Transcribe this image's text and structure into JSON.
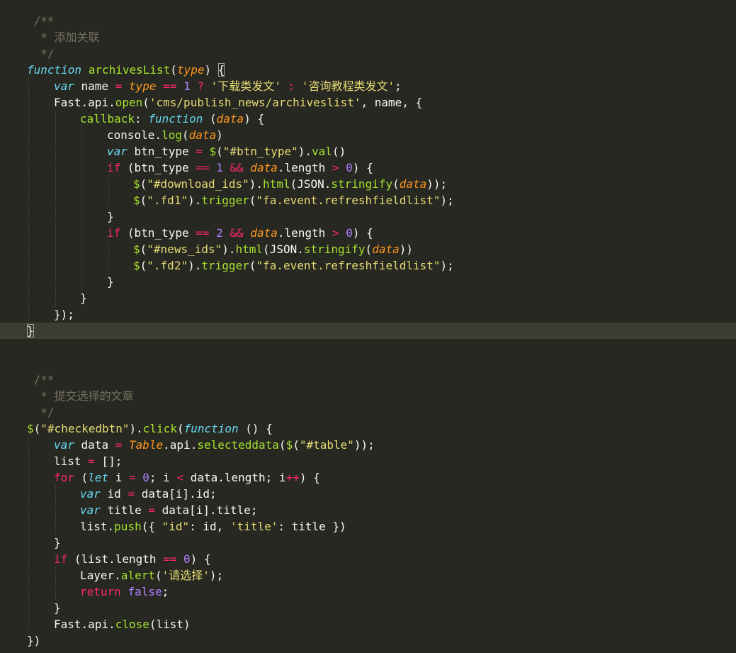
{
  "editor": {
    "theme": "monokai",
    "colors": {
      "background": "#272822",
      "active_line": "#3e3d32",
      "text": "#f8f8f2",
      "comment": "#75715e",
      "keyword": "#66d9ef",
      "function": "#a6e22e",
      "parameter": "#fd971f",
      "string": "#e6db74",
      "operator": "#f92672",
      "number": "#ae81ff"
    },
    "active_line_index": 19,
    "lines": [
      {
        "indent": 0,
        "tokens": [
          [
            " /**",
            "c"
          ]
        ]
      },
      {
        "indent": 0,
        "tokens": [
          [
            "  * 添加关联",
            "c"
          ]
        ]
      },
      {
        "indent": 0,
        "tokens": [
          [
            "  */",
            "c"
          ]
        ]
      },
      {
        "indent": 0,
        "tokens": [
          [
            "function",
            "k"
          ],
          [
            " ",
            "p"
          ],
          [
            "archivesList",
            "f"
          ],
          [
            "(",
            "p"
          ],
          [
            "type",
            "a"
          ],
          [
            ") ",
            "p"
          ],
          [
            "{",
            "p",
            "box"
          ]
        ]
      },
      {
        "indent": 1,
        "tokens": [
          [
            "var",
            "k"
          ],
          [
            " name ",
            "p"
          ],
          [
            "=",
            "o"
          ],
          [
            " ",
            "p"
          ],
          [
            "type",
            "a"
          ],
          [
            " ",
            "p"
          ],
          [
            "==",
            "o"
          ],
          [
            " ",
            "p"
          ],
          [
            "1",
            "n"
          ],
          [
            " ",
            "p"
          ],
          [
            "?",
            "o"
          ],
          [
            " ",
            "p"
          ],
          [
            "'下载类发文'",
            "s"
          ],
          [
            " ",
            "p"
          ],
          [
            ":",
            "o"
          ],
          [
            " ",
            "p"
          ],
          [
            "'咨询教程类发文'",
            "s"
          ],
          [
            ";",
            "p"
          ]
        ]
      },
      {
        "indent": 1,
        "tokens": [
          [
            "Fast",
            "p"
          ],
          [
            ".",
            "p"
          ],
          [
            "api",
            "p"
          ],
          [
            ".",
            "p"
          ],
          [
            "open",
            "f"
          ],
          [
            "(",
            "p"
          ],
          [
            "'cms/publish_news/archiveslist'",
            "s"
          ],
          [
            ", name, {",
            "p"
          ]
        ]
      },
      {
        "indent": 2,
        "tokens": [
          [
            "callback",
            "f"
          ],
          [
            ": ",
            "p"
          ],
          [
            "function",
            "k"
          ],
          [
            " (",
            "p"
          ],
          [
            "data",
            "a"
          ],
          [
            ") {",
            "p"
          ]
        ]
      },
      {
        "indent": 3,
        "tokens": [
          [
            "console",
            "p"
          ],
          [
            ".",
            "p"
          ],
          [
            "log",
            "f"
          ],
          [
            "(",
            "p"
          ],
          [
            "data",
            "a"
          ],
          [
            ")",
            "p"
          ]
        ]
      },
      {
        "indent": 3,
        "tokens": [
          [
            "var",
            "k"
          ],
          [
            " btn_type ",
            "p"
          ],
          [
            "=",
            "o"
          ],
          [
            " ",
            "p"
          ],
          [
            "$",
            "f"
          ],
          [
            "(",
            "p"
          ],
          [
            "\"#btn_type\"",
            "s"
          ],
          [
            ").",
            "p"
          ],
          [
            "val",
            "f"
          ],
          [
            "()",
            "p"
          ]
        ]
      },
      {
        "indent": 3,
        "tokens": [
          [
            "if",
            "ctl"
          ],
          [
            " (btn_type ",
            "p"
          ],
          [
            "==",
            "o"
          ],
          [
            " ",
            "p"
          ],
          [
            "1",
            "n"
          ],
          [
            " ",
            "p"
          ],
          [
            "&&",
            "o"
          ],
          [
            " ",
            "p"
          ],
          [
            "data",
            "a"
          ],
          [
            ".length ",
            "p"
          ],
          [
            ">",
            "o"
          ],
          [
            " ",
            "p"
          ],
          [
            "0",
            "n"
          ],
          [
            ") {",
            "p"
          ]
        ]
      },
      {
        "indent": 4,
        "tokens": [
          [
            "$",
            "f"
          ],
          [
            "(",
            "p"
          ],
          [
            "\"#download_ids\"",
            "s"
          ],
          [
            ").",
            "p"
          ],
          [
            "html",
            "f"
          ],
          [
            "(JSON.",
            "p"
          ],
          [
            "stringify",
            "f"
          ],
          [
            "(",
            "p"
          ],
          [
            "data",
            "a"
          ],
          [
            "));",
            "p"
          ]
        ]
      },
      {
        "indent": 4,
        "tokens": [
          [
            "$",
            "f"
          ],
          [
            "(",
            "p"
          ],
          [
            "\".fd1\"",
            "s"
          ],
          [
            ").",
            "p"
          ],
          [
            "trigger",
            "f"
          ],
          [
            "(",
            "p"
          ],
          [
            "\"fa.event.refreshfieldlist\"",
            "s"
          ],
          [
            ");",
            "p"
          ]
        ]
      },
      {
        "indent": 3,
        "tokens": [
          [
            "}",
            "p"
          ]
        ]
      },
      {
        "indent": 3,
        "tokens": [
          [
            "if",
            "ctl"
          ],
          [
            " (btn_type ",
            "p"
          ],
          [
            "==",
            "o"
          ],
          [
            " ",
            "p"
          ],
          [
            "2",
            "n"
          ],
          [
            " ",
            "p"
          ],
          [
            "&&",
            "o"
          ],
          [
            " ",
            "p"
          ],
          [
            "data",
            "a"
          ],
          [
            ".length ",
            "p"
          ],
          [
            ">",
            "o"
          ],
          [
            " ",
            "p"
          ],
          [
            "0",
            "n"
          ],
          [
            ") {",
            "p"
          ]
        ]
      },
      {
        "indent": 4,
        "tokens": [
          [
            "$",
            "f"
          ],
          [
            "(",
            "p"
          ],
          [
            "\"#news_ids\"",
            "s"
          ],
          [
            ").",
            "p"
          ],
          [
            "html",
            "f"
          ],
          [
            "(JSON.",
            "p"
          ],
          [
            "stringify",
            "f"
          ],
          [
            "(",
            "p"
          ],
          [
            "data",
            "a"
          ],
          [
            "))",
            "p"
          ]
        ]
      },
      {
        "indent": 4,
        "tokens": [
          [
            "$",
            "f"
          ],
          [
            "(",
            "p"
          ],
          [
            "\".fd2\"",
            "s"
          ],
          [
            ").",
            "p"
          ],
          [
            "trigger",
            "f"
          ],
          [
            "(",
            "p"
          ],
          [
            "\"fa.event.refreshfieldlist\"",
            "s"
          ],
          [
            ");",
            "p"
          ]
        ]
      },
      {
        "indent": 3,
        "tokens": [
          [
            "}",
            "p"
          ]
        ]
      },
      {
        "indent": 2,
        "tokens": [
          [
            "}",
            "p"
          ]
        ]
      },
      {
        "indent": 1,
        "tokens": [
          [
            "});",
            "p"
          ]
        ]
      },
      {
        "indent": 0,
        "tokens": [
          [
            "}",
            "p",
            "box"
          ]
        ]
      },
      {
        "indent": 0,
        "tokens": []
      },
      {
        "indent": 0,
        "tokens": []
      },
      {
        "indent": 0,
        "tokens": [
          [
            " /**",
            "c"
          ]
        ]
      },
      {
        "indent": 0,
        "tokens": [
          [
            "  * 提交选择的文章",
            "c"
          ]
        ]
      },
      {
        "indent": 0,
        "tokens": [
          [
            "  */",
            "c"
          ]
        ]
      },
      {
        "indent": 0,
        "tokens": [
          [
            "$",
            "f"
          ],
          [
            "(",
            "p"
          ],
          [
            "\"#checkedbtn\"",
            "s"
          ],
          [
            ").",
            "p"
          ],
          [
            "click",
            "f"
          ],
          [
            "(",
            "p"
          ],
          [
            "function",
            "k"
          ],
          [
            " () {",
            "p"
          ]
        ]
      },
      {
        "indent": 1,
        "tokens": [
          [
            "var",
            "k"
          ],
          [
            " data ",
            "p"
          ],
          [
            "=",
            "o"
          ],
          [
            " ",
            "p"
          ],
          [
            "Table",
            "cl"
          ],
          [
            ".api.",
            "p"
          ],
          [
            "selecteddata",
            "f"
          ],
          [
            "(",
            "p"
          ],
          [
            "$",
            "f"
          ],
          [
            "(",
            "p"
          ],
          [
            "\"#table\"",
            "s"
          ],
          [
            "));",
            "p"
          ]
        ]
      },
      {
        "indent": 1,
        "tokens": [
          [
            "list ",
            "p"
          ],
          [
            "=",
            "o"
          ],
          [
            " [];",
            "p"
          ]
        ]
      },
      {
        "indent": 1,
        "tokens": [
          [
            "for",
            "ctl"
          ],
          [
            " (",
            "p"
          ],
          [
            "let",
            "kp"
          ],
          [
            " i ",
            "p"
          ],
          [
            "=",
            "o"
          ],
          [
            " ",
            "p"
          ],
          [
            "0",
            "n"
          ],
          [
            "; i ",
            "p"
          ],
          [
            "<",
            "o"
          ],
          [
            " data.length; i",
            "p"
          ],
          [
            "++",
            "o"
          ],
          [
            ") {",
            "p"
          ]
        ]
      },
      {
        "indent": 2,
        "tokens": [
          [
            "var",
            "k"
          ],
          [
            " id ",
            "p"
          ],
          [
            "=",
            "o"
          ],
          [
            " data[i].id;",
            "p"
          ]
        ]
      },
      {
        "indent": 2,
        "tokens": [
          [
            "var",
            "k"
          ],
          [
            " title ",
            "p"
          ],
          [
            "=",
            "o"
          ],
          [
            " data[i].title;",
            "p"
          ]
        ]
      },
      {
        "indent": 2,
        "tokens": [
          [
            "list.",
            "p"
          ],
          [
            "push",
            "f"
          ],
          [
            "({ ",
            "p"
          ],
          [
            "\"id\"",
            "s"
          ],
          [
            ": id, ",
            "p"
          ],
          [
            "'title'",
            "s"
          ],
          [
            ": title })",
            "p"
          ]
        ]
      },
      {
        "indent": 1,
        "tokens": [
          [
            "}",
            "p"
          ]
        ]
      },
      {
        "indent": 1,
        "tokens": [
          [
            "if",
            "ctl"
          ],
          [
            " (list.length ",
            "p"
          ],
          [
            "==",
            "o"
          ],
          [
            " ",
            "p"
          ],
          [
            "0",
            "n"
          ],
          [
            ") {",
            "p"
          ]
        ]
      },
      {
        "indent": 2,
        "tokens": [
          [
            "Layer.",
            "p"
          ],
          [
            "alert",
            "f"
          ],
          [
            "(",
            "p"
          ],
          [
            "'请选择'",
            "s"
          ],
          [
            ");",
            "p"
          ]
        ]
      },
      {
        "indent": 2,
        "tokens": [
          [
            "return",
            "ctl"
          ],
          [
            " ",
            "p"
          ],
          [
            "false",
            "b"
          ],
          [
            ";",
            "p"
          ]
        ]
      },
      {
        "indent": 1,
        "tokens": [
          [
            "}",
            "p"
          ]
        ]
      },
      {
        "indent": 1,
        "tokens": [
          [
            "Fast.api.",
            "p"
          ],
          [
            "close",
            "f"
          ],
          [
            "(list)",
            "p"
          ]
        ]
      },
      {
        "indent": 0,
        "tokens": [
          [
            "})",
            "p"
          ]
        ]
      }
    ]
  }
}
